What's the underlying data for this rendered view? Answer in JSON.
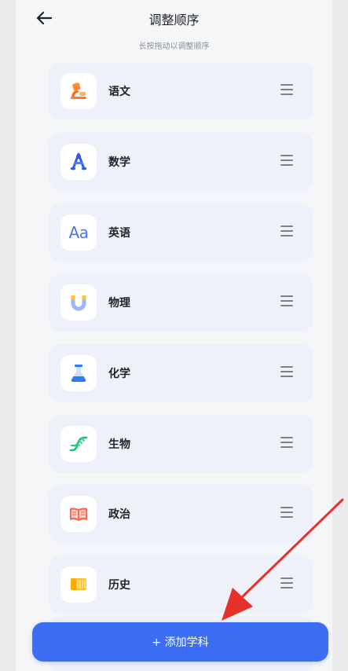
{
  "header": {
    "title": "调整顺序",
    "subtitle": "长按拖动以调整顺序"
  },
  "subjects": [
    {
      "label": "语文",
      "icon": "chinese-subject-icon"
    },
    {
      "label": "数学",
      "icon": "math-subject-icon"
    },
    {
      "label": "英语",
      "icon": "english-subject-icon",
      "glyph": "Aa"
    },
    {
      "label": "物理",
      "icon": "physics-magnet-icon"
    },
    {
      "label": "化学",
      "icon": "chemistry-flask-icon"
    },
    {
      "label": "生物",
      "icon": "biology-dna-icon"
    },
    {
      "label": "政治",
      "icon": "politics-book-icon"
    },
    {
      "label": "历史",
      "icon": "history-scroll-icon"
    }
  ],
  "footer": {
    "add_button_label": "+ 添加学科"
  },
  "colors": {
    "accent": "#3b6df5",
    "card_bg": "#eef0fa",
    "annotation_arrow": "#e8302a"
  }
}
